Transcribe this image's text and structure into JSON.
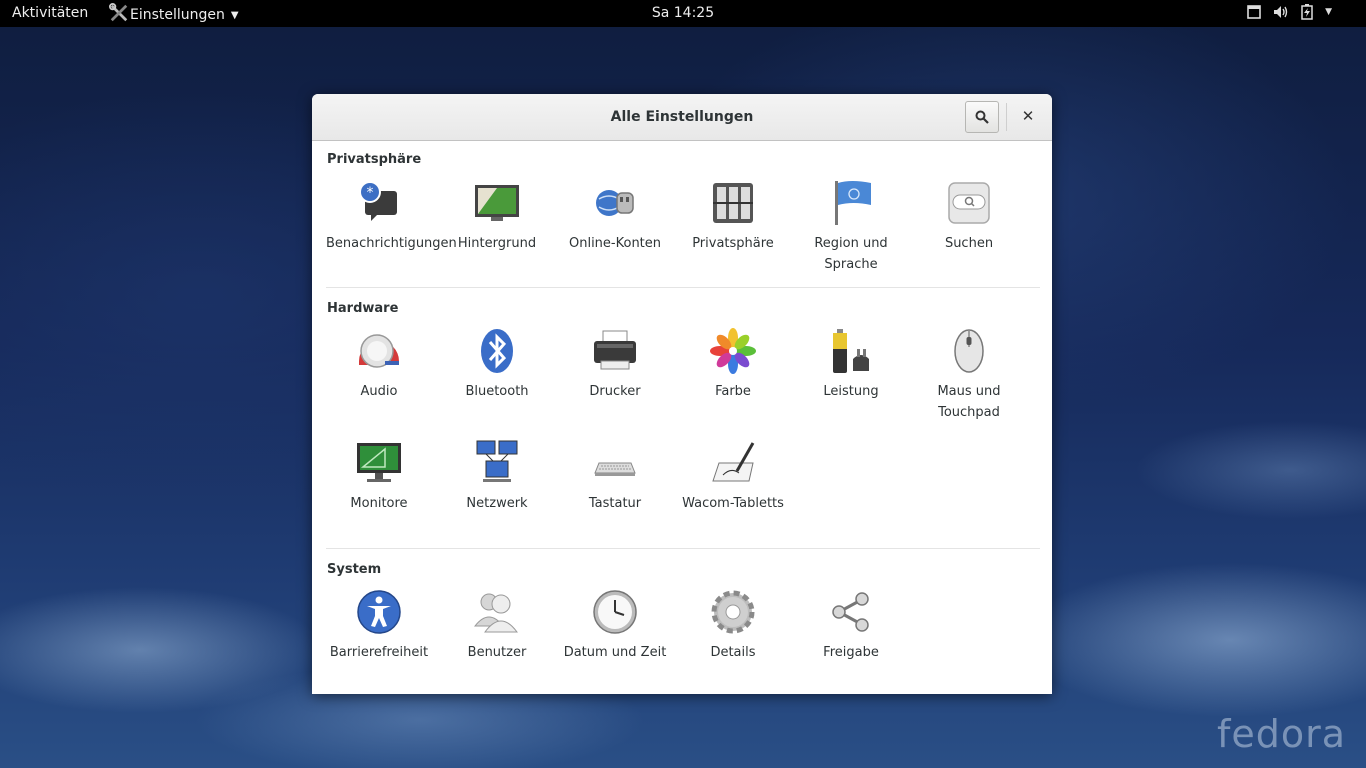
{
  "topbar": {
    "activities": "Aktivitäten",
    "app_name": "Einstellungen",
    "clock": "Sa 14:25"
  },
  "window": {
    "title": "Alle Einstellungen"
  },
  "sections": {
    "privacy": {
      "title": "Privatsphäre",
      "items": [
        {
          "label": "Benachrichtigungen"
        },
        {
          "label": "Hintergrund"
        },
        {
          "label": "Online-Konten"
        },
        {
          "label": "Privatsphäre"
        },
        {
          "label": "Region und Sprache"
        },
        {
          "label": "Suchen"
        }
      ]
    },
    "hardware": {
      "title": "Hardware",
      "items": [
        {
          "label": "Audio"
        },
        {
          "label": "Bluetooth"
        },
        {
          "label": "Drucker"
        },
        {
          "label": "Farbe"
        },
        {
          "label": "Leistung"
        },
        {
          "label": "Maus und Touchpad"
        },
        {
          "label": "Monitore"
        },
        {
          "label": "Netzwerk"
        },
        {
          "label": "Tastatur"
        },
        {
          "label": "Wacom-Tabletts"
        }
      ]
    },
    "system": {
      "title": "System",
      "items": [
        {
          "label": "Barrierefreiheit"
        },
        {
          "label": "Benutzer"
        },
        {
          "label": "Datum und Zeit"
        },
        {
          "label": "Details"
        },
        {
          "label": "Freigabe"
        }
      ]
    }
  },
  "watermark": "fedora"
}
